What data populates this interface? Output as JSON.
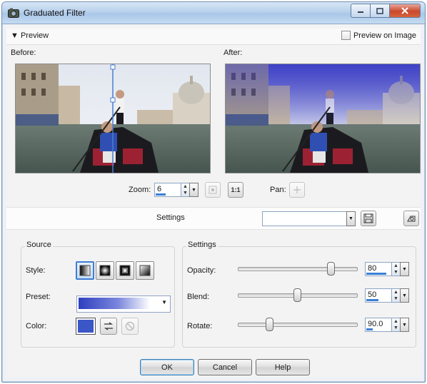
{
  "window": {
    "title": "Graduated Filter",
    "app_icon": "gradfilter-app-icon"
  },
  "preview": {
    "toggle_label": "Preview",
    "preview_on_image_label": "Preview on Image",
    "preview_on_image_checked": false,
    "before_label": "Before:",
    "after_label": "After:",
    "zoom_label": "Zoom:",
    "zoom_value": "6",
    "pan_label": "Pan:",
    "fit_icon": "fit-to-window-icon",
    "actual_size_label": "1:1",
    "pan_icon": "pan-move-icon"
  },
  "settings_bar": {
    "label": "Settings",
    "preset_value": "",
    "save_icon": "save-disk-icon",
    "reset_icon": "reset-icon"
  },
  "source": {
    "title": "Source",
    "style_label": "Style:",
    "style_options": [
      "linear-style-icon",
      "radial-style-icon",
      "rectangular-style-icon",
      "corner-style-icon"
    ],
    "style_selected_index": 0,
    "preset_label": "Preset:",
    "color_label": "Color:",
    "color_value": "#3a56c7",
    "swap_icon": "swap-arrows-icon",
    "none_icon": "no-color-icon"
  },
  "settings": {
    "title": "Settings",
    "opacity_label": "Opacity:",
    "opacity_value": "80",
    "blend_label": "Blend:",
    "blend_value": "50",
    "rotate_label": "Rotate:",
    "rotate_value": "90.0"
  },
  "buttons": {
    "ok": "OK",
    "cancel": "Cancel",
    "help": "Help"
  },
  "colors": {
    "accent": "#3a7fd5",
    "gradient_color": "#3a56c7"
  }
}
